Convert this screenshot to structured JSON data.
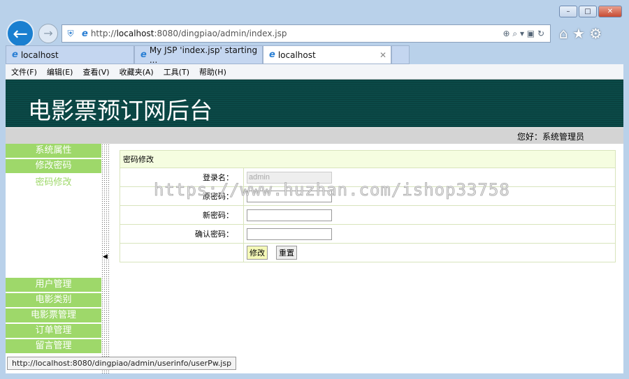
{
  "browser": {
    "url_prefix": "http://",
    "url_host": "localhost",
    "url_rest": ":8080/dingpiao/admin/index.jsp",
    "tabs": [
      {
        "label": "localhost"
      },
      {
        "label": "My JSP 'index.jsp' starting ..."
      },
      {
        "label": "localhost"
      }
    ],
    "menu": [
      "文件(F)",
      "编辑(E)",
      "查看(V)",
      "收藏夹(A)",
      "工具(T)",
      "帮助(H)"
    ],
    "status_url": "http://localhost:8080/dingpiao/admin/userinfo/userPw.jsp"
  },
  "header": {
    "title": "电影票预订网后台",
    "greeting": "您好：系统管理员"
  },
  "sidebar": {
    "top": [
      "系统属性",
      "修改密码"
    ],
    "sub": "密码修改",
    "bottom": [
      "用户管理",
      "电影类别",
      "电影票管理",
      "订单管理",
      "留言管理"
    ]
  },
  "form": {
    "title": "密码修改",
    "login_label": "登录名：",
    "login_value": "admin",
    "old_label": "原密码：",
    "new_label": "新密码：",
    "confirm_label": "确认密码：",
    "submit": "修改",
    "reset": "重置"
  },
  "watermark": "https://www.huzhan.com/ishop33758"
}
